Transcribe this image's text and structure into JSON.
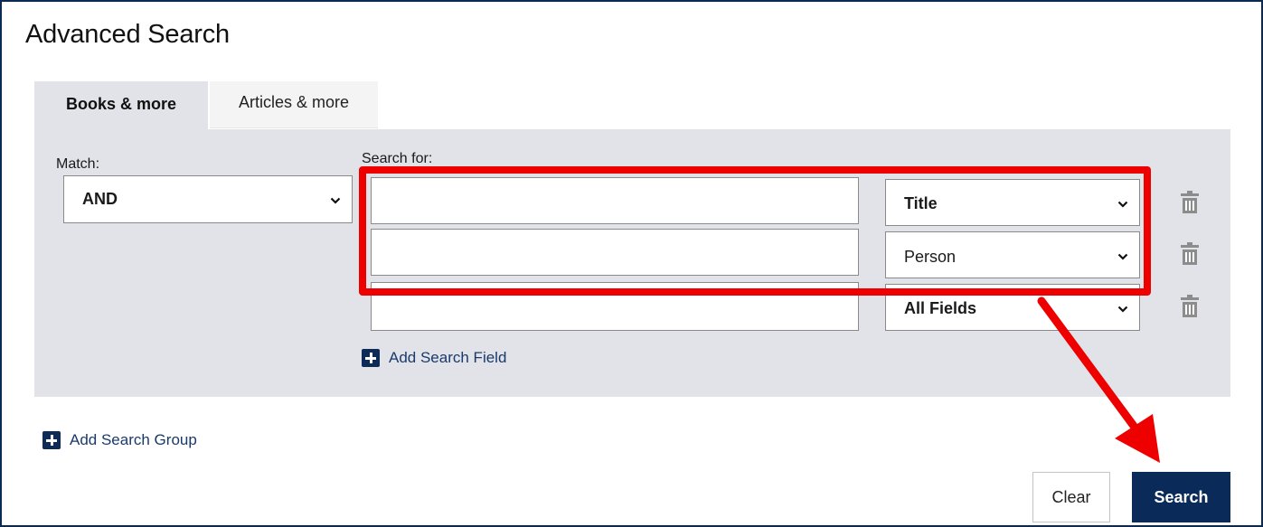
{
  "page": {
    "title": "Advanced Search"
  },
  "tabs": [
    {
      "label": "Books & more",
      "active": true
    },
    {
      "label": "Articles & more",
      "active": false
    }
  ],
  "group": {
    "match_label": "Match:",
    "match_value": "AND",
    "search_for_label": "Search for:",
    "rows": [
      {
        "value": "",
        "field": "Title"
      },
      {
        "value": "",
        "field": "Person"
      },
      {
        "value": "",
        "field": "All Fields"
      }
    ],
    "add_field_label": "Add Search Field"
  },
  "add_group_label": "Add Search Group",
  "actions": {
    "clear_label": "Clear",
    "search_label": "Search"
  },
  "icons": {
    "delete": "trash-icon",
    "add": "plus-square-icon",
    "dropdown": "chevron-down-icon"
  },
  "colors": {
    "primary_navy": "#0a2a5a",
    "panel_gray": "#e1e3e8",
    "annotation_red": "#ee0000"
  }
}
